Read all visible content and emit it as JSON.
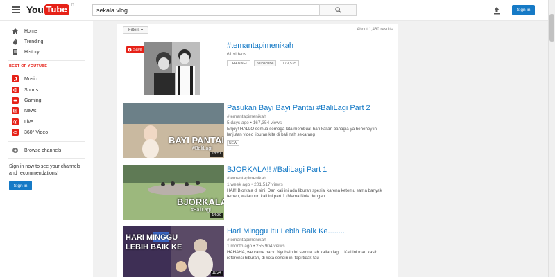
{
  "masthead": {
    "logo_you": "You",
    "logo_tube": "Tube",
    "logo_region": "ID",
    "search_value": "sekala vlog",
    "signin_label": "Sign in"
  },
  "sidebar": {
    "main_items": [
      {
        "label": "Home",
        "icon": "home-icon"
      },
      {
        "label": "Trending",
        "icon": "trending-icon"
      },
      {
        "label": "History",
        "icon": "history-icon"
      }
    ],
    "section_title": "BEST OF YOUTUBE",
    "best_items": [
      {
        "label": "Music",
        "icon": "music-icon"
      },
      {
        "label": "Sports",
        "icon": "sports-icon"
      },
      {
        "label": "Gaming",
        "icon": "gaming-icon"
      },
      {
        "label": "News",
        "icon": "news-icon"
      },
      {
        "label": "Live",
        "icon": "live-icon"
      },
      {
        "label": "360° Video",
        "icon": "video-360-icon"
      }
    ],
    "browse_channels": "Browse channels",
    "signin_prompt": "Sign in now to see your channels and recommendations!",
    "signin_button": "Sign in"
  },
  "results": {
    "filters_label": "Filters ▾",
    "about_text": "About 1,460 results",
    "items": [
      {
        "kind": "playlist",
        "title": "#temantapimenikah",
        "meta": "61 videos",
        "tag_channel": "CHANNEL",
        "tag_subscribe": "Subscribe",
        "subscriber_count": "179,535",
        "save_label": "Save"
      },
      {
        "kind": "video",
        "title": "Pasukan Bayi Bayi Pantai #BaliLagi Part 2",
        "channel": "#temantapimenikah",
        "meta": "5 days ago • 167,354 views",
        "desc": "Enjoy! HALLO semua semoga kita membuat hari kalian bahagia ya hehehey ini lanjutan video liburan kita di bali nah sekarang",
        "badge": "NEW",
        "thumb_text": "BAYI PANTAI",
        "thumb_sub": "#BaliLagi",
        "duration": "18:51"
      },
      {
        "kind": "video",
        "title": "BJORKALA!! #BaliLagi Part 1",
        "channel": "#temantapimenikah",
        "meta": "1 week ago • 201,517 views",
        "desc": "HAI!! Bjorkala di sini. Dan kali ini ada liburan spesial karena ketemu sama banyak temen, walaupun kali ini part 1 (Mama Nola dengan",
        "thumb_text": "BJORKALA",
        "thumb_sub": "#BaliLagi",
        "duration": "14:30"
      },
      {
        "kind": "video",
        "title": "Hari Minggu Itu Lebih Baik Ke........",
        "channel": "#temantapimenikah",
        "meta": "1 month ago • 255,904 views",
        "desc": "HAHAHA, we came back! Nyobain ini semua lah kalian lagi... Kali ini mau kasih referensi hiburan, di kota sendiri ini tapi tidak tau",
        "thumb_text": "HARI MINGGU",
        "thumb_sub": "LEBIH BAIK KE",
        "duration": "11:24"
      }
    ]
  },
  "colors": {
    "accent_red": "#e62117",
    "link_blue": "#167ac6",
    "button_blue": "#167ac6"
  }
}
